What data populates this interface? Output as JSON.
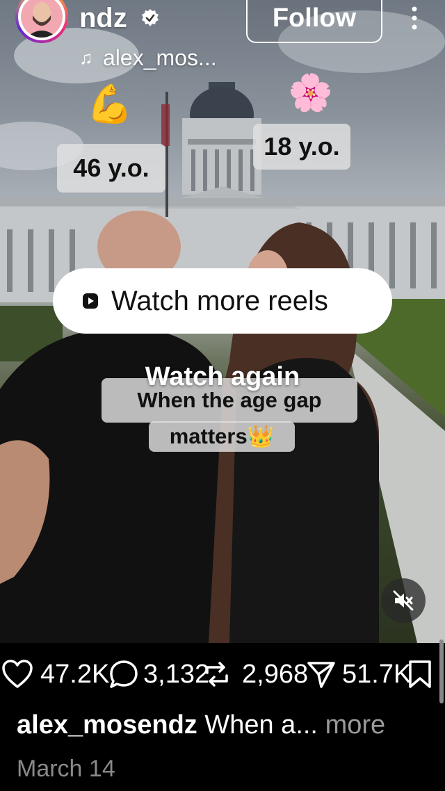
{
  "header": {
    "username": "ndz",
    "follow_label": "Follow",
    "music_icon": "♫",
    "music_text": "alex_mos..."
  },
  "stickers": {
    "age_left": "46 y.o.",
    "age_right": "18 y.o.",
    "emoji_arm": "💪",
    "emoji_flower": "🌸"
  },
  "overlay": {
    "watch_more_label": "Watch more reels",
    "watch_again_label": "Watch again"
  },
  "video_caption": {
    "line1": "When the age gap",
    "line2": "matters👑"
  },
  "actions": {
    "likes": "47.2K",
    "comments": "3,132",
    "reposts": "2,968",
    "shares": "51.7K"
  },
  "post": {
    "author": "alex_mosendz",
    "caption_preview": "When a...",
    "more_label": "more",
    "date": "March 14"
  },
  "colors": {
    "background": "#000000",
    "muted_text": "#8a8a8a"
  },
  "icons": [
    "verified-badge-icon",
    "more-options-icon",
    "music-note-icon",
    "reels-icon",
    "mute-icon",
    "heart-icon",
    "comment-icon",
    "repost-icon",
    "share-icon",
    "bookmark-icon"
  ]
}
